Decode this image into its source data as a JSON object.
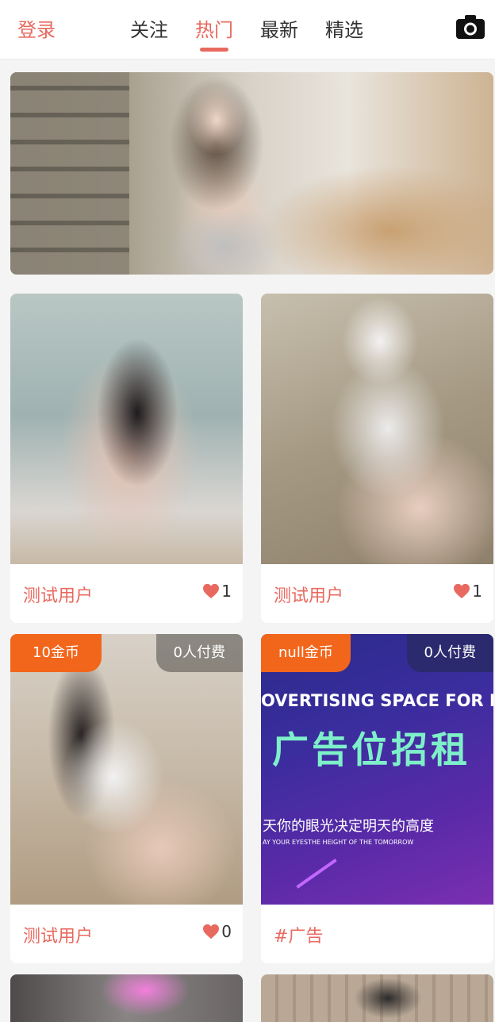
{
  "header": {
    "login_label": "登录",
    "tabs": [
      {
        "label": "关注",
        "active": false
      },
      {
        "label": "热门",
        "active": true
      },
      {
        "label": "最新",
        "active": false
      },
      {
        "label": "精选",
        "active": false
      }
    ],
    "camera_icon": "camera-icon"
  },
  "colors": {
    "accent": "#e8695f",
    "price_badge": "#f2661c"
  },
  "banner": {
    "alt": "banner-photo"
  },
  "cards": [
    {
      "user": "测试用户",
      "likes": "1",
      "liked": true
    },
    {
      "user": "测试用户",
      "likes": "1",
      "liked": true
    },
    {
      "user": "测试用户",
      "likes": "0",
      "liked": true,
      "price": "10金币",
      "paid": "0人付费"
    },
    {
      "user": "#广告",
      "price": "null金币",
      "paid": "0人付费",
      "ad_text": {
        "line1": "OVERTISING SPACE FOR RENT",
        "line2": "广告位招租",
        "line3": "天你的眼光决定明天的高度",
        "line4": "AY YOUR EYESTHE HEIGHT OF THE TOMORROW"
      }
    }
  ]
}
